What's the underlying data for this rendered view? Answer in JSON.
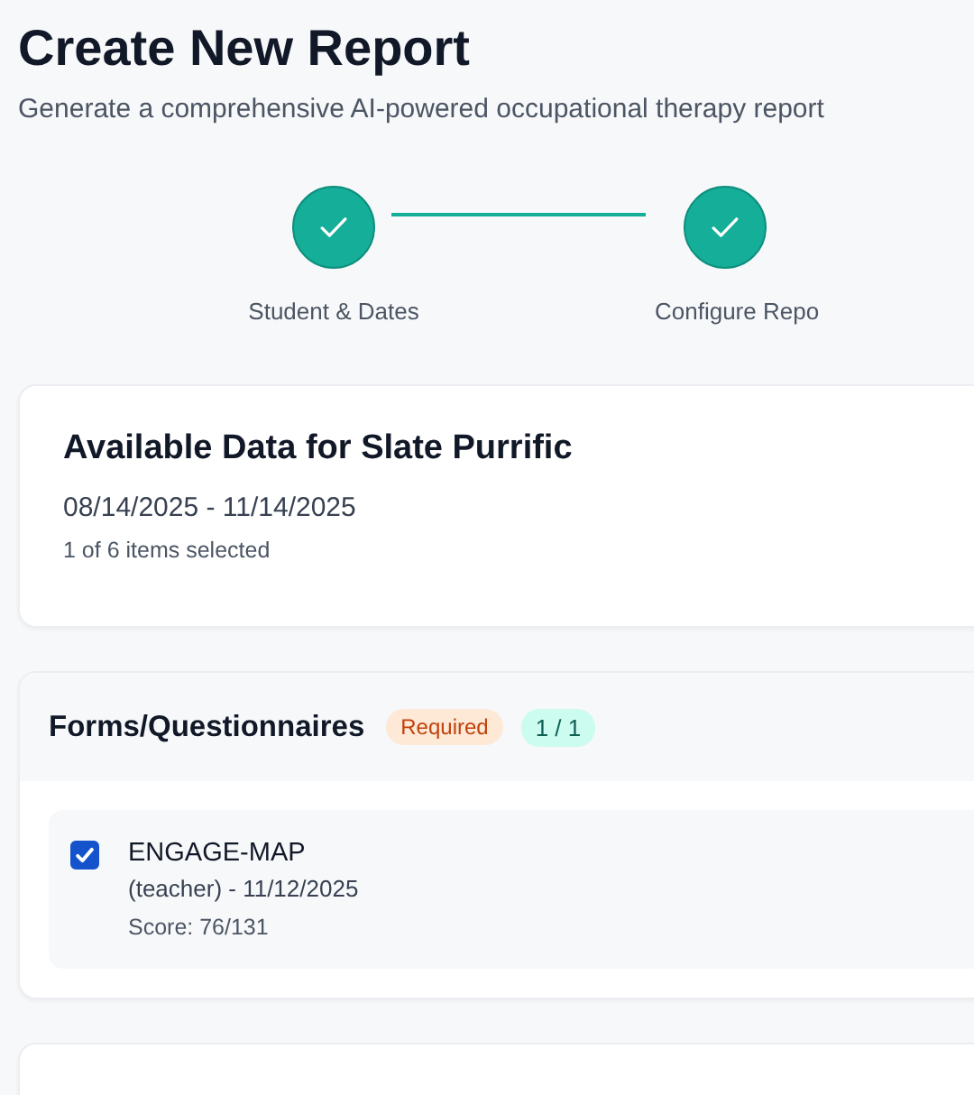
{
  "header": {
    "title": "Create New Report",
    "subtitle": "Generate a comprehensive AI-powered occupational therapy report"
  },
  "steps": [
    {
      "label": "Student & Dates",
      "completed": true
    },
    {
      "label": "Configure Repo",
      "completed": true
    }
  ],
  "summary": {
    "title": "Available Data for Slate Purrific",
    "date_range": "08/14/2025 - 11/14/2025",
    "selection_count": "1 of 6 items selected"
  },
  "sections": [
    {
      "title": "Forms/Questionnaires",
      "required_badge": "Required",
      "count_badge": "1 / 1",
      "items": [
        {
          "name": "ENGAGE-MAP",
          "detail": "(teacher) - 11/12/2025",
          "score": "Score: 76/131",
          "checked": true
        }
      ]
    }
  ]
}
